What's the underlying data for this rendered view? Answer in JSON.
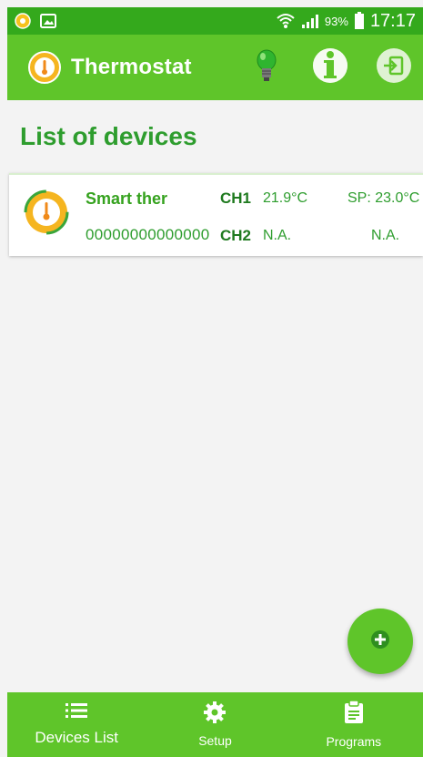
{
  "status_bar": {
    "left_icons": [
      "app-notification-icon",
      "image-icon"
    ],
    "battery_percent": "93%",
    "time": "17:17",
    "right_icons": [
      "wifi-icon",
      "signal-icon",
      "battery-icon"
    ]
  },
  "app_bar": {
    "title": "Thermostat",
    "actions": [
      "lightbulb-icon",
      "info-icon",
      "logout-icon"
    ]
  },
  "main": {
    "section_title": "List of devices",
    "devices": [
      {
        "name": "Smart ther",
        "id": "00000000000000",
        "ch1_label": "CH1",
        "ch1_temp": "21.9°C",
        "ch1_setpoint": "SP: 23.0°C",
        "ch2_label": "CH2",
        "ch2_temp": "N.A.",
        "ch2_setpoint": "N.A."
      }
    ]
  },
  "fab": {
    "icon": "plus-icon"
  },
  "bottom_nav": {
    "items": [
      {
        "label": "Devices List",
        "icon": "list-icon",
        "active": true
      },
      {
        "label": "Setup",
        "icon": "gear-icon",
        "active": false
      },
      {
        "label": "Programs",
        "icon": "clipboard-icon",
        "active": false
      }
    ]
  },
  "colors": {
    "status_bar": "#34a91c",
    "primary": "#5fc52a",
    "accent_text": "#2e9d2e",
    "background": "#f3f3f3"
  }
}
